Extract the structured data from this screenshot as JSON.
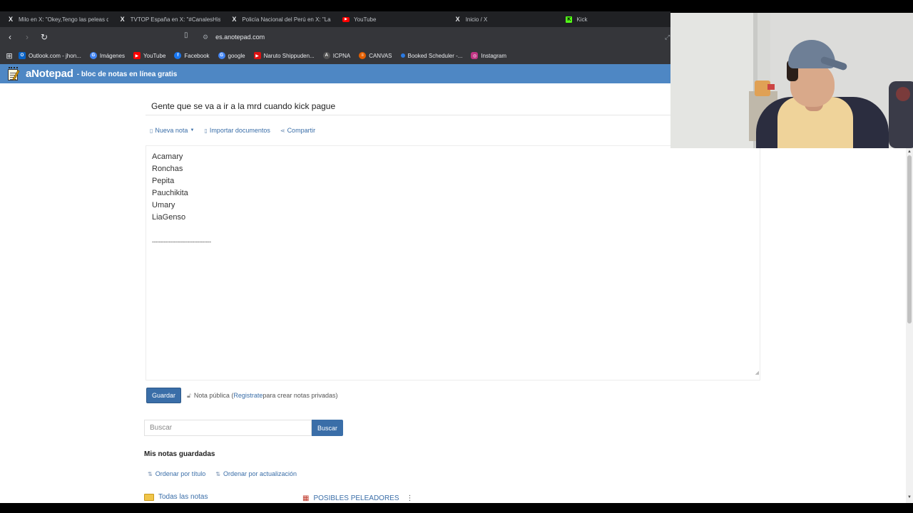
{
  "browser": {
    "tabs": [
      {
        "icon": "x-icon",
        "glyph": "X",
        "label": "Milo en X: \"Okey,Tengo las peleas qu",
        "active": false
      },
      {
        "icon": "x-icon",
        "glyph": "X",
        "label": "TVTOP España en X: \"#CanalesHispa",
        "active": false
      },
      {
        "icon": "x-icon",
        "glyph": "X",
        "label": "Policía Nacional del Perú en X: \"La @",
        "active": false
      },
      {
        "icon": "youtube-icon",
        "glyph": "▶",
        "label": "YouTube",
        "active": false
      },
      {
        "icon": "x-icon",
        "glyph": "X",
        "label": "Inicio / X",
        "active": false
      },
      {
        "icon": "kick-icon",
        "glyph": "K",
        "label": "Kick",
        "active": true
      }
    ],
    "url": "es.anotepad.com",
    "bookmarks": [
      {
        "label": "Outlook.com - jhon...",
        "color": "#0a64c8",
        "glyph": "O"
      },
      {
        "label": "Imágenes",
        "color": "#4285f4",
        "glyph": "G"
      },
      {
        "label": "YouTube",
        "color": "#ff0000",
        "glyph": "▶"
      },
      {
        "label": "Facebook",
        "color": "#1877f2",
        "glyph": "f"
      },
      {
        "label": "google",
        "color": "#4285f4",
        "glyph": "G"
      },
      {
        "label": "Naruto Shippuden...",
        "color": "#d11",
        "glyph": "▶"
      },
      {
        "label": "ICPNA",
        "color": "#555",
        "glyph": "A"
      },
      {
        "label": "CANVAS",
        "color": "#e66000",
        "glyph": "≡"
      },
      {
        "label": "Booked Scheduler -...",
        "color": "#2a7ae2",
        "glyph": "•"
      },
      {
        "label": "Instagram",
        "color": "#c13584",
        "glyph": "◎"
      }
    ]
  },
  "site": {
    "logo": "aNotepad",
    "tagline": "- bloc de notas en línea gratis"
  },
  "note": {
    "title": "Gente que se va a ir a la mrd cuando kick pague",
    "toolbar": {
      "new_note": "Nueva nota",
      "import_docs": "Importar documentos",
      "share": "Compartir"
    },
    "lines": [
      "Acamary",
      "Ronchas",
      "Pepita",
      "Pauchikita",
      "Umary",
      "LiaGenso",
      "",
      "-----------------------------------"
    ],
    "save_label": "Guardar",
    "public_prefix": "Nota pública (",
    "register_link": "Registrate",
    "public_suffix": " para crear notas privadas)"
  },
  "search": {
    "placeholder": "Buscar",
    "button": "Buscar"
  },
  "saved": {
    "title": "Mis notas guardadas",
    "sort_title": "Ordenar por título",
    "sort_update": "Ordenar por actualización",
    "all_notes": "Todas las notas",
    "folder_posibles": "POSIBLES PELEADORES"
  }
}
